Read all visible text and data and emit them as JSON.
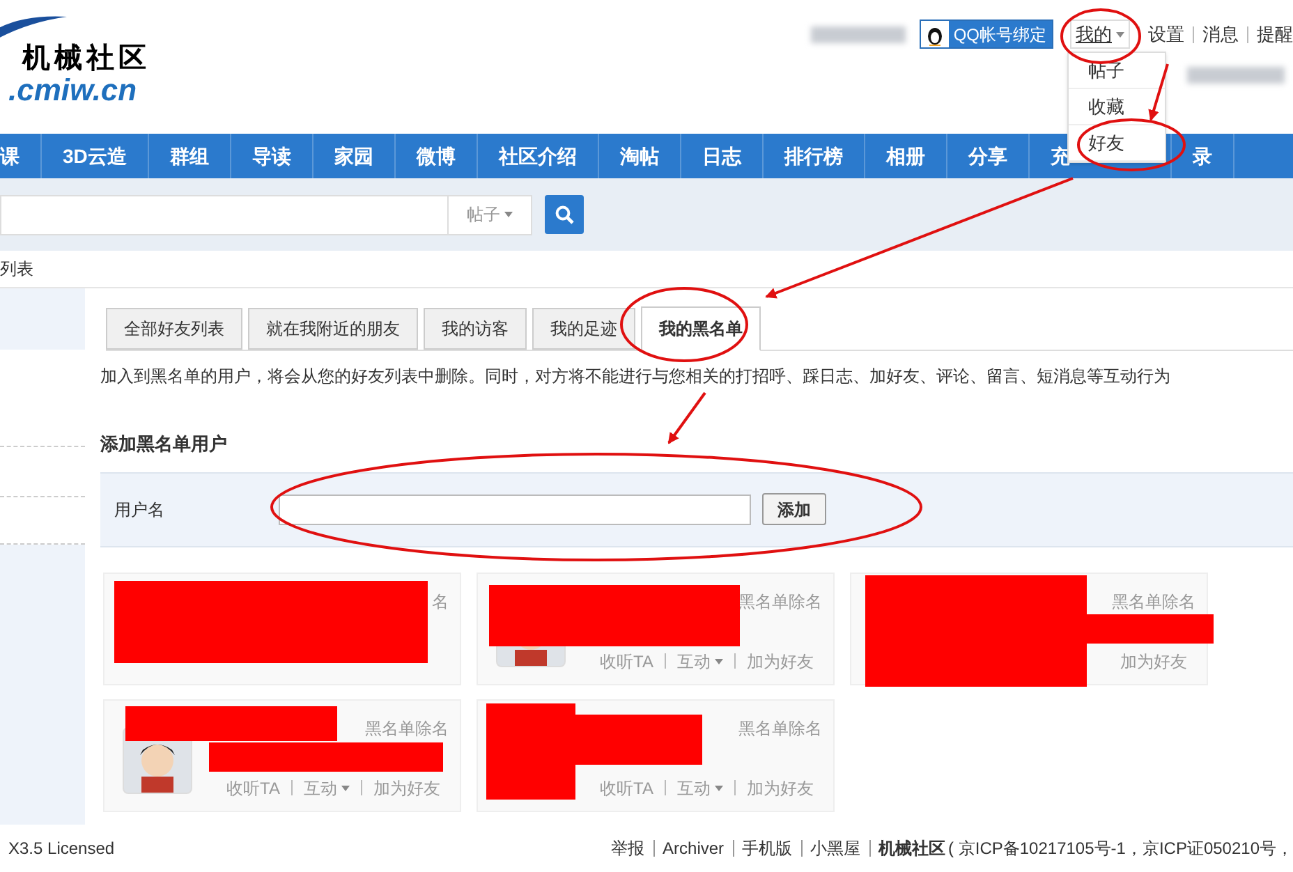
{
  "logo": {
    "name": "机械社区",
    "domain": ".cmiw.cn"
  },
  "user_bar": {
    "qq_button": "QQ帐号绑定",
    "menu": {
      "label": "我的",
      "expanded": true,
      "items": [
        "帖子",
        "收藏",
        "好友"
      ]
    },
    "links": [
      "设置",
      "消息",
      "提醒"
    ]
  },
  "nav": [
    "课",
    "3D云造",
    "群组",
    "导读",
    "家园",
    "微博",
    "社区介绍",
    "淘帖",
    "日志",
    "排行榜",
    "相册",
    "分享",
    "充",
    "录"
  ],
  "search": {
    "type": "帖子"
  },
  "breadcrumb": "列表",
  "tabs": [
    {
      "label": "全部好友列表",
      "selected": false
    },
    {
      "label": "就在我附近的朋友",
      "selected": false
    },
    {
      "label": "我的访客",
      "selected": false
    },
    {
      "label": "我的足迹",
      "selected": false
    },
    {
      "label": "我的黑名单",
      "selected": true
    }
  ],
  "notice": "加入到黑名单的用户，将会从您的好友列表中删除。同时，对方将不能进行与您相关的打招呼、踩日志、加好友、评论、留言、短消息等互动行为",
  "add_form": {
    "title": "添加黑名单用户",
    "label": "用户名",
    "button": "添加"
  },
  "cards": [
    {
      "remove": "名",
      "avatar": false
    },
    {
      "remove": "黑名单除名",
      "avatar": true,
      "actions": [
        {
          "label": "收听TA",
          "kind": "link"
        },
        {
          "label": "互动",
          "kind": "menu"
        },
        {
          "label": "加为好友",
          "kind": "link"
        }
      ]
    },
    {
      "remove": "黑名单除名",
      "avatar": false,
      "actions": [
        {
          "label": "加为好友",
          "kind": "link"
        }
      ]
    },
    {
      "remove": "黑名单除名",
      "avatar": true,
      "actions": [
        {
          "label": "收听TA",
          "kind": "link"
        },
        {
          "label": "互动",
          "kind": "menu"
        },
        {
          "label": "加为好友",
          "kind": "link"
        }
      ]
    },
    {
      "remove": "黑名单除名",
      "avatar": false,
      "actions": [
        {
          "label": "收听TA",
          "kind": "link"
        },
        {
          "label": "互动",
          "kind": "menu"
        },
        {
          "label": "加为好友",
          "kind": "link"
        }
      ]
    }
  ],
  "footer": {
    "left": "X3.5 Licensed",
    "links": [
      "举报",
      "Archiver",
      "手机版",
      "小黑屋"
    ],
    "site": "机械社区",
    "icp": "( 京ICP备10217105号-1，京ICP证050210号，"
  }
}
